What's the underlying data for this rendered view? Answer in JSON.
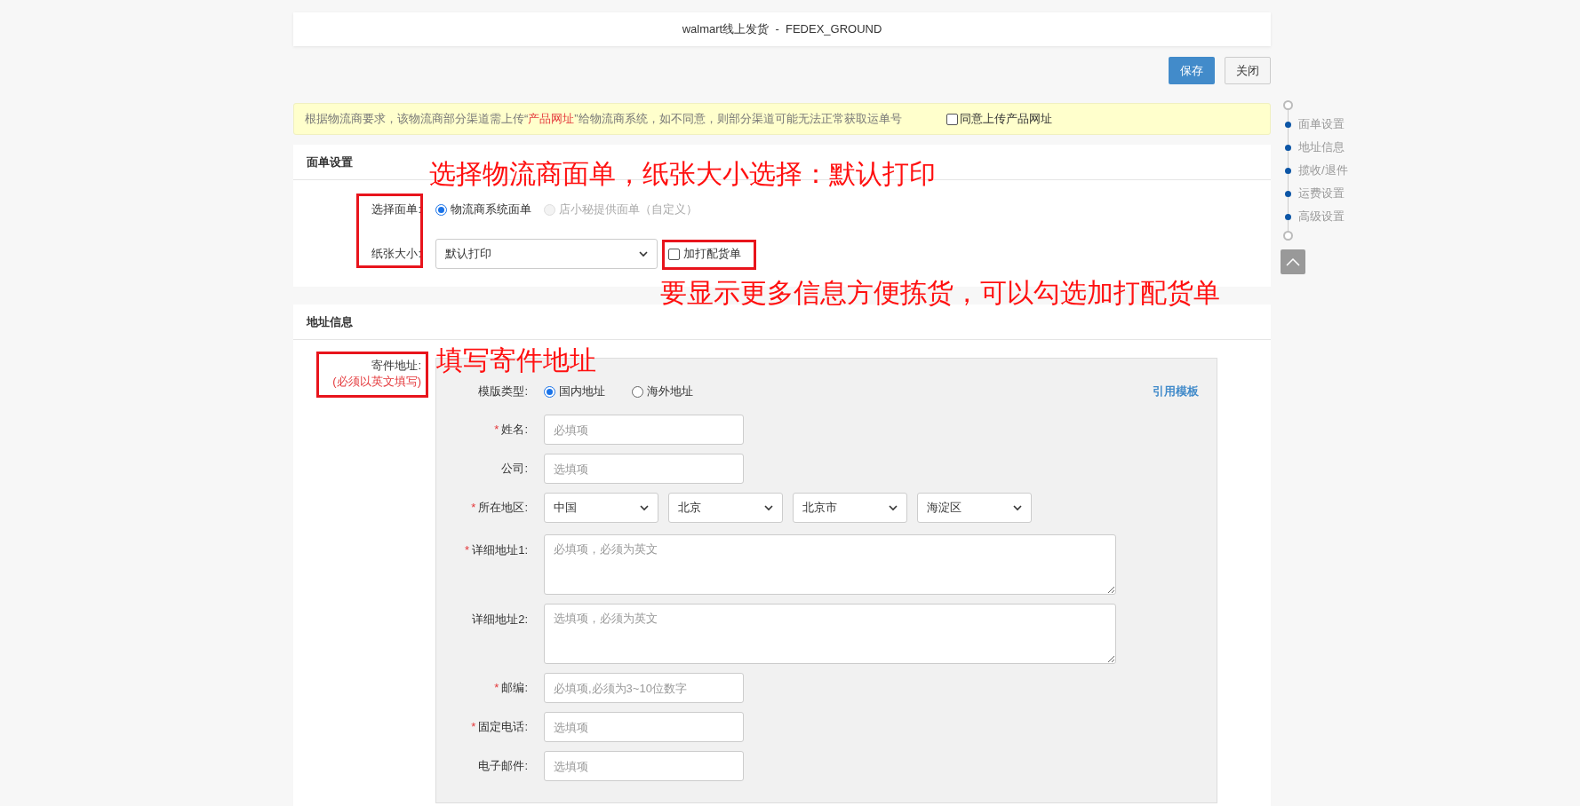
{
  "header": {
    "title": "walmart线上发货  -  FEDEX_GROUND"
  },
  "actions": [
    {
      "label": "保存",
      "kind": "primary"
    },
    {
      "label": "关闭",
      "kind": "default"
    }
  ],
  "notice": {
    "text_before": "根据物流商要求，该物流商部分渠道需上传“",
    "highlight": "产品网址",
    "text_after": "”给物流商系统，如不同意，则部分渠道可能无法正常获取运单号",
    "agree": {
      "label": "同意上传产品网址",
      "checked": false
    }
  },
  "label_section": {
    "title": "面单设置",
    "label_type": {
      "label": "选择面单:",
      "options": [
        {
          "label": "物流商系统面单",
          "selected": true,
          "disabled": false
        },
        {
          "label": "店小秘提供面单（自定义）",
          "selected": false,
          "disabled": true
        }
      ]
    },
    "paper": {
      "label": "纸张大小:",
      "value": "默认打印",
      "extra": {
        "label": "加打配货单",
        "checked": false
      }
    }
  },
  "address_section": {
    "title": "地址信息",
    "sender_label": "寄件地址:",
    "sender_note": "(必须以英文填写)",
    "template_type": {
      "label": "模版类型:",
      "options": [
        {
          "label": "国内地址",
          "selected": true
        },
        {
          "label": "海外地址",
          "selected": false
        }
      ]
    },
    "template_link": "引用模板",
    "required_mark": "*",
    "fields": [
      {
        "kind": "input",
        "label": "姓名:",
        "required": true,
        "placeholder": "必填项"
      },
      {
        "kind": "input",
        "label": "公司:",
        "required": false,
        "placeholder": "选填项"
      },
      {
        "kind": "selects",
        "label": "所在地区:",
        "required": true,
        "values": [
          "中国",
          "北京",
          "北京市",
          "海淀区"
        ]
      },
      {
        "kind": "textarea",
        "label": "详细地址1:",
        "required": true,
        "placeholder": "必填项，必须为英文"
      },
      {
        "kind": "textarea",
        "label": "详细地址2:",
        "required": false,
        "placeholder": "选填项，必须为英文"
      },
      {
        "kind": "input",
        "label": "邮编:",
        "required": true,
        "placeholder": "必填项,必须为3~10位数字"
      },
      {
        "kind": "input",
        "label": "固定电话:",
        "required": true,
        "placeholder": "选填项"
      },
      {
        "kind": "input",
        "label": "电子邮件:",
        "required": false,
        "placeholder": "选填项"
      }
    ]
  },
  "nav": {
    "items": [
      "面单设置",
      "地址信息",
      "揽收/退件",
      "运费设置",
      "高级设置"
    ]
  },
  "annotations": [
    "选择物流商面单，纸张大小选择：默认打印",
    "要显示更多信息方便拣货，可以勾选加打配货单",
    "填写寄件地址"
  ]
}
